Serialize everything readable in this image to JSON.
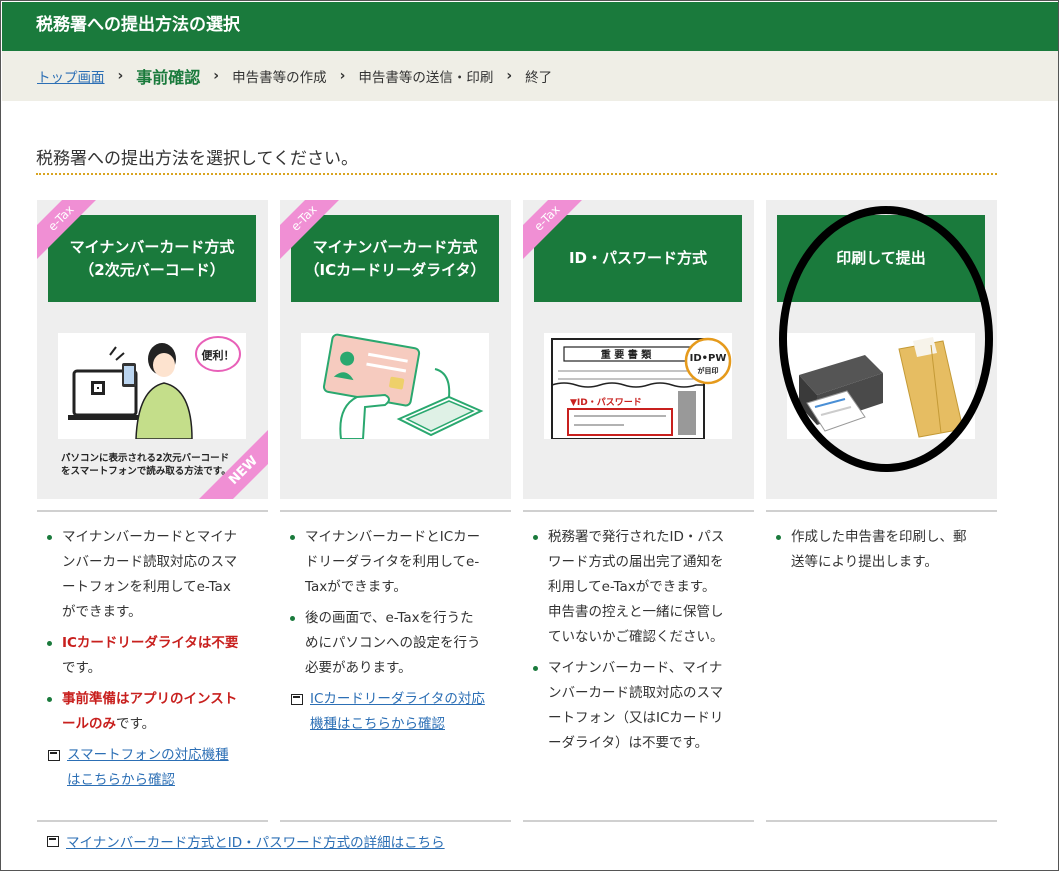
{
  "header": {
    "title": "税務署への提出方法の選択"
  },
  "breadcrumb": {
    "top_link": "トップ画面",
    "current": "事前確認",
    "step3": "申告書等の作成",
    "step4": "申告書等の送信・印刷",
    "step5": "終了",
    "separator": "›"
  },
  "lead": "税務署への提出方法を選択してください。",
  "cards": [
    {
      "ribbon": "e-Tax",
      "title_line1": "マイナンバーカード方式",
      "title_line2": "（2次元バーコード）",
      "illus_bubble": "便利！",
      "caption_line1": "パソコンに表示される2次元バーコード",
      "caption_line2": "をスマートフォンで読み取る方法です。",
      "new_badge": "NEW",
      "bullets": [
        {
          "text": "マイナンバーカードとマイナンバーカード読取対応のスマートフォンを利用してe-Taxができます。"
        },
        {
          "red": "ICカードリーダライタは不要",
          "text": "です。"
        },
        {
          "red": "事前準備はアプリのインストールのみ",
          "text": "です。"
        }
      ],
      "link": "スマートフォンの対応機種はこちらから確認"
    },
    {
      "ribbon": "e-Tax",
      "title_line1": "マイナンバーカード方式",
      "title_line2": "（ICカードリーダライタ）",
      "bullets": [
        {
          "text": "マイナンバーカードとICカードリーダライタを利用してe-Taxができます。"
        },
        {
          "text": "後の画面で、e-Taxを行うためにパソコンへの設定を行う必要があります。"
        }
      ],
      "link": "ICカードリーダライタの対応機種はこちらから確認"
    },
    {
      "ribbon": "e-Tax",
      "title_line1": "ID・パスワード方式",
      "illus_doc_title": "重 要 書 類",
      "illus_badge": "ID•PW",
      "illus_badge_sub": "が目印",
      "illus_label": "▼ID・パスワード",
      "bullets": [
        {
          "text": "税務署で発行されたID・パスワード方式の届出完了通知を利用してe-Taxができます。申告書の控えと一緒に保管していないかご確認ください。"
        },
        {
          "text": "マイナンバーカード、マイナンバーカード読取対応のスマートフォン（又はICカードリーダライタ）は不要です。"
        }
      ]
    },
    {
      "title_line1": "印刷して提出",
      "bullets": [
        {
          "text": "作成した申告書を印刷し、郵送等により提出します。"
        }
      ]
    }
  ],
  "bottom_link": "マイナンバーカード方式とID・パスワード方式の詳細はこちら",
  "colors": {
    "brand_green": "#1a7a3c",
    "etax_pink": "#f08fd4",
    "alert_red": "#c8201e",
    "link_blue": "#2c6fb5"
  }
}
